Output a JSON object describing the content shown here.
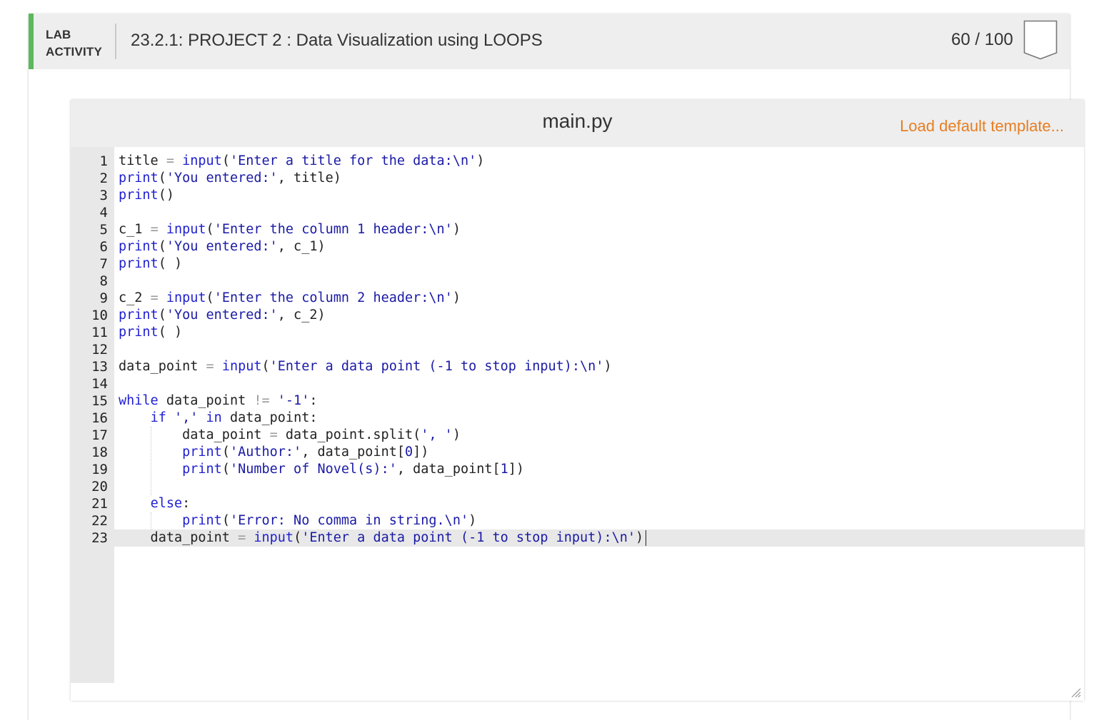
{
  "activity": {
    "type_line1": "LAB",
    "type_line2": "ACTIVITY",
    "title": "23.2.1: PROJECT 2 : Data Visualization using LOOPS",
    "score": "60 / 100",
    "accent_color": "#5cb85c"
  },
  "editor": {
    "filename": "main.py",
    "load_template_label": "Load default template...",
    "active_line": 23,
    "lines": [
      {
        "num": "1",
        "text": "title = input('Enter a title for the data:\\n')"
      },
      {
        "num": "2",
        "text": "print('You entered:', title)"
      },
      {
        "num": "3",
        "text": "print()"
      },
      {
        "num": "4",
        "text": ""
      },
      {
        "num": "5",
        "text": "c_1 = input('Enter the column 1 header:\\n')"
      },
      {
        "num": "6",
        "text": "print('You entered:', c_1)"
      },
      {
        "num": "7",
        "text": "print( )"
      },
      {
        "num": "8",
        "text": ""
      },
      {
        "num": "9",
        "text": "c_2 = input('Enter the column 2 header:\\n')"
      },
      {
        "num": "10",
        "text": "print('You entered:', c_2)"
      },
      {
        "num": "11",
        "text": "print( )"
      },
      {
        "num": "12",
        "text": ""
      },
      {
        "num": "13",
        "text": "data_point = input('Enter a data point (-1 to stop input):\\n')"
      },
      {
        "num": "14",
        "text": ""
      },
      {
        "num": "15",
        "text": "while data_point != '-1':"
      },
      {
        "num": "16",
        "text": "    if ',' in data_point:"
      },
      {
        "num": "17",
        "text": "        data_point = data_point.split(', ')"
      },
      {
        "num": "18",
        "text": "        print('Author:', data_point[0])"
      },
      {
        "num": "19",
        "text": "        print('Number of Novel(s):', data_point[1])"
      },
      {
        "num": "20",
        "text": ""
      },
      {
        "num": "21",
        "text": "    else:"
      },
      {
        "num": "22",
        "text": "        print('Error: No comma in string.\\n')"
      },
      {
        "num": "23",
        "text": "    data_point = input('Enter a data point (-1 to stop input):\\n')"
      }
    ]
  },
  "syntax_colors": {
    "keyword": "#1f1fd1",
    "string": "#1a1aa6",
    "number": "#1a1aa6",
    "plain": "#222222",
    "operator": "#999999"
  }
}
